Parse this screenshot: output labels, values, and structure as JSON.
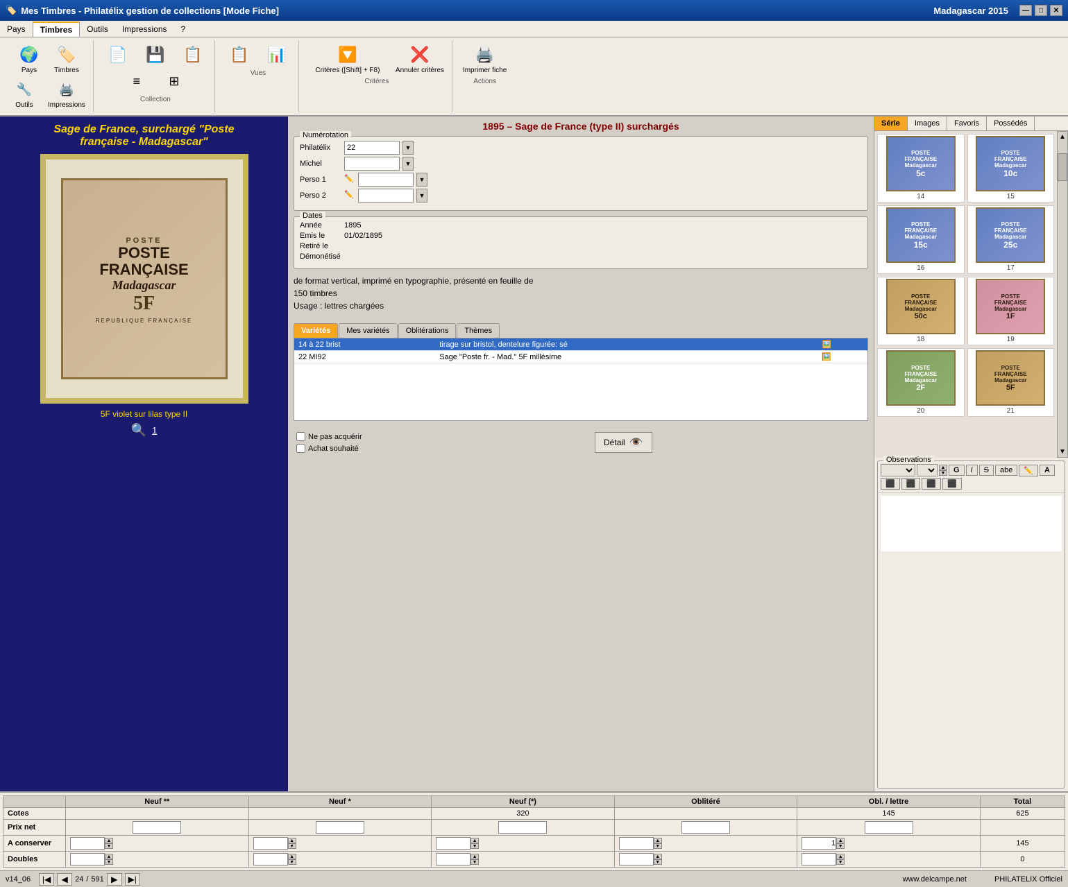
{
  "window": {
    "title": "Mes Timbres - Philatélix gestion de collections [Mode Fiche]",
    "subtitle": "Madagascar 2015",
    "min_label": "—",
    "max_label": "□",
    "close_label": "✕"
  },
  "menu": {
    "items": [
      "Pays",
      "Timbres",
      "Outils",
      "Impressions",
      "?"
    ],
    "active": "Timbres"
  },
  "toolbar": {
    "groups": [
      {
        "label": "",
        "buttons": [
          {
            "icon": "🌍",
            "label": "Pays"
          },
          {
            "icon": "🏷️",
            "label": "Timbres"
          }
        ]
      },
      {
        "label": "",
        "buttons": [
          {
            "icon": "🔧",
            "label": "Outils"
          },
          {
            "icon": "🖨️",
            "label": "Impressions"
          }
        ]
      },
      {
        "label": "Collection",
        "buttons": [
          {
            "icon": "📄",
            "label": ""
          },
          {
            "icon": "💾",
            "label": ""
          },
          {
            "icon": "📋",
            "label": ""
          }
        ]
      },
      {
        "label": "Vues",
        "buttons": [
          {
            "icon": "📋",
            "label": ""
          },
          {
            "icon": "📊",
            "label": ""
          }
        ]
      },
      {
        "label": "Critères",
        "buttons": [
          {
            "icon": "🔽",
            "label": "Critères ([Shift] + F8)"
          },
          {
            "icon": "❌",
            "label": "Annuler critères"
          }
        ]
      },
      {
        "label": "Actions",
        "buttons": [
          {
            "icon": "🖨️",
            "label": "Imprimer fiche"
          }
        ]
      }
    ]
  },
  "series_title": "1895 – Sage de France (type II) surchargés",
  "stamp": {
    "title_line1": "Sage de France, surchargé \"Poste",
    "title_line2": "française - Madagascar\"",
    "poste_label": "POSTE",
    "main_text_line1": "POSTE",
    "main_text_line2": "FRANÇAISE",
    "overlay": "Madagascar",
    "value": "5F",
    "footer": "REPUBLIQUE FRANÇAISE",
    "description": "5F violet sur lilas type II",
    "page_num": "1"
  },
  "numerotation": {
    "label": "Numérotation",
    "philatelix_label": "Philatélix",
    "philatelix_value": "22",
    "michel_label": "Michel",
    "michel_value": "",
    "perso1_label": "Perso 1",
    "perso1_value": "",
    "perso2_label": "Perso 2",
    "perso2_value": ""
  },
  "dates": {
    "label": "Dates",
    "annee_label": "Année",
    "annee_value": "1895",
    "emis_label": "Emis le",
    "emis_value": "01/02/1895",
    "retire_label": "Retiré le",
    "retire_value": "",
    "demonetise_label": "Démonétisé",
    "demonetise_value": ""
  },
  "description": {
    "text1": "de format vertical, imprimé en typographie, présenté en feuille de",
    "text2": "150 timbres",
    "text3": "Usage : lettres chargées"
  },
  "tabs": {
    "items": [
      "Variétés",
      "Mes variétés",
      "Oblitérations",
      "Thèmes"
    ],
    "active": "Variétés"
  },
  "varieties": [
    {
      "code": "14 à 22 brist",
      "desc": "tirage sur bristol, dentelure figurée: sé"
    },
    {
      "code": "22 MI92",
      "desc": "Sage \"Poste fr. - Mad.\" 5F millésime"
    }
  ],
  "right_tabs": [
    "Série",
    "Images",
    "Favoris",
    "Possédés"
  ],
  "right_active_tab": "Série",
  "thumbnails": [
    {
      "num": "14",
      "color": "blue"
    },
    {
      "num": "15",
      "color": "blue"
    },
    {
      "num": "16",
      "color": "blue"
    },
    {
      "num": "17",
      "color": "blue"
    },
    {
      "num": "18",
      "color": "brown"
    },
    {
      "num": "19",
      "color": "pink"
    },
    {
      "num": "20",
      "color": "green"
    },
    {
      "num": "21",
      "color": "brown"
    }
  ],
  "bottom": {
    "columns": [
      "Neuf **",
      "Neuf *",
      "Neuf (*)",
      "Oblitéré",
      "Obl. / lettre",
      "Total"
    ],
    "rows": {
      "cotes": {
        "label": "Cotes",
        "values": [
          "",
          "",
          "320",
          "",
          "145",
          "625"
        ]
      },
      "prix_net": {
        "label": "Prix net",
        "values": [
          "",
          "",
          "",
          "",
          "",
          ""
        ]
      },
      "a_conserver": {
        "label": "A conserver",
        "values": [
          "",
          "",
          "",
          "",
          "1",
          ""
        ],
        "total": "145"
      },
      "doubles": {
        "label": "Doubles",
        "values": [
          "",
          "",
          "",
          "",
          "",
          ""
        ],
        "total": "0"
      }
    }
  },
  "checkboxes": {
    "ne_pas_acquerir": "Ne pas acquérir",
    "achat_souhaite": "Achat souhaité"
  },
  "detail_btn": "Détail",
  "observations": {
    "label": "Observations",
    "toolbar_items": [
      "font-select",
      "size-select",
      "up-down",
      "G",
      "I",
      "S",
      "abe",
      "✏️",
      "A",
      "align-left",
      "align-center",
      "align-right",
      "align-justify"
    ]
  },
  "status": {
    "version": "v14_06",
    "current": "24",
    "total": "591",
    "url": "www.delcampe.net",
    "credit": "PHILATELIX Officiel"
  }
}
